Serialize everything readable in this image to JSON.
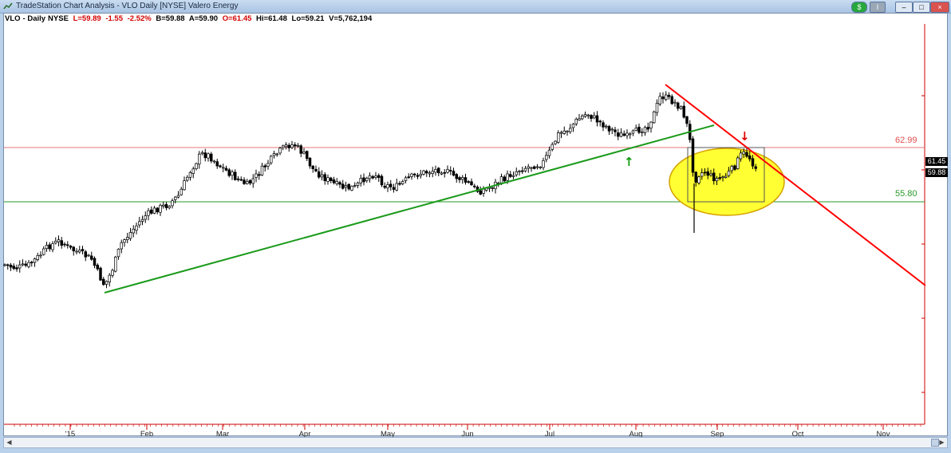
{
  "window": {
    "title": "TradeStation Chart Analysis - VLO Daily [NYSE] Valero Energy",
    "buttons": [
      "$",
      "I",
      "–",
      "□",
      "×"
    ]
  },
  "infobar": {
    "symbol": "VLO",
    "interval": "- Daily",
    "exchange": "NYSE",
    "last": "L=59.89",
    "change": "-1.55",
    "pct": "-2.52%",
    "bid": "B=59.88",
    "ask": "A=59.90",
    "open": "O=61.45",
    "high": "Hi=61.48",
    "low": "Lo=59.21",
    "volume": "V=5,762,194"
  },
  "price_tags": {
    "top": "61.45",
    "bottom": "59.88"
  },
  "chart_data": {
    "type": "candlestick",
    "x_labels": [
      "'15",
      "Feb",
      "Mar",
      "Apr",
      "May",
      "Jun",
      "Jul",
      "Aug",
      "Sep",
      "Oct",
      "Nov"
    ],
    "horizontal_lines": [
      {
        "value": 62.99,
        "label": "62.99",
        "color": "#e05050"
      },
      {
        "value": 55.8,
        "label": "55.80",
        "color": "#2a9a2a"
      }
    ],
    "grid": false,
    "colors": {
      "up_candle": "#ffffff",
      "down_candle": "#000000",
      "support_trend": "#1a9a1a",
      "resistance_trend": "#ff0000",
      "highlight": "#ffff33",
      "axis": "#cc0000"
    }
  },
  "annotations": {
    "up_arrow": "↑",
    "down_arrow": "↓"
  }
}
